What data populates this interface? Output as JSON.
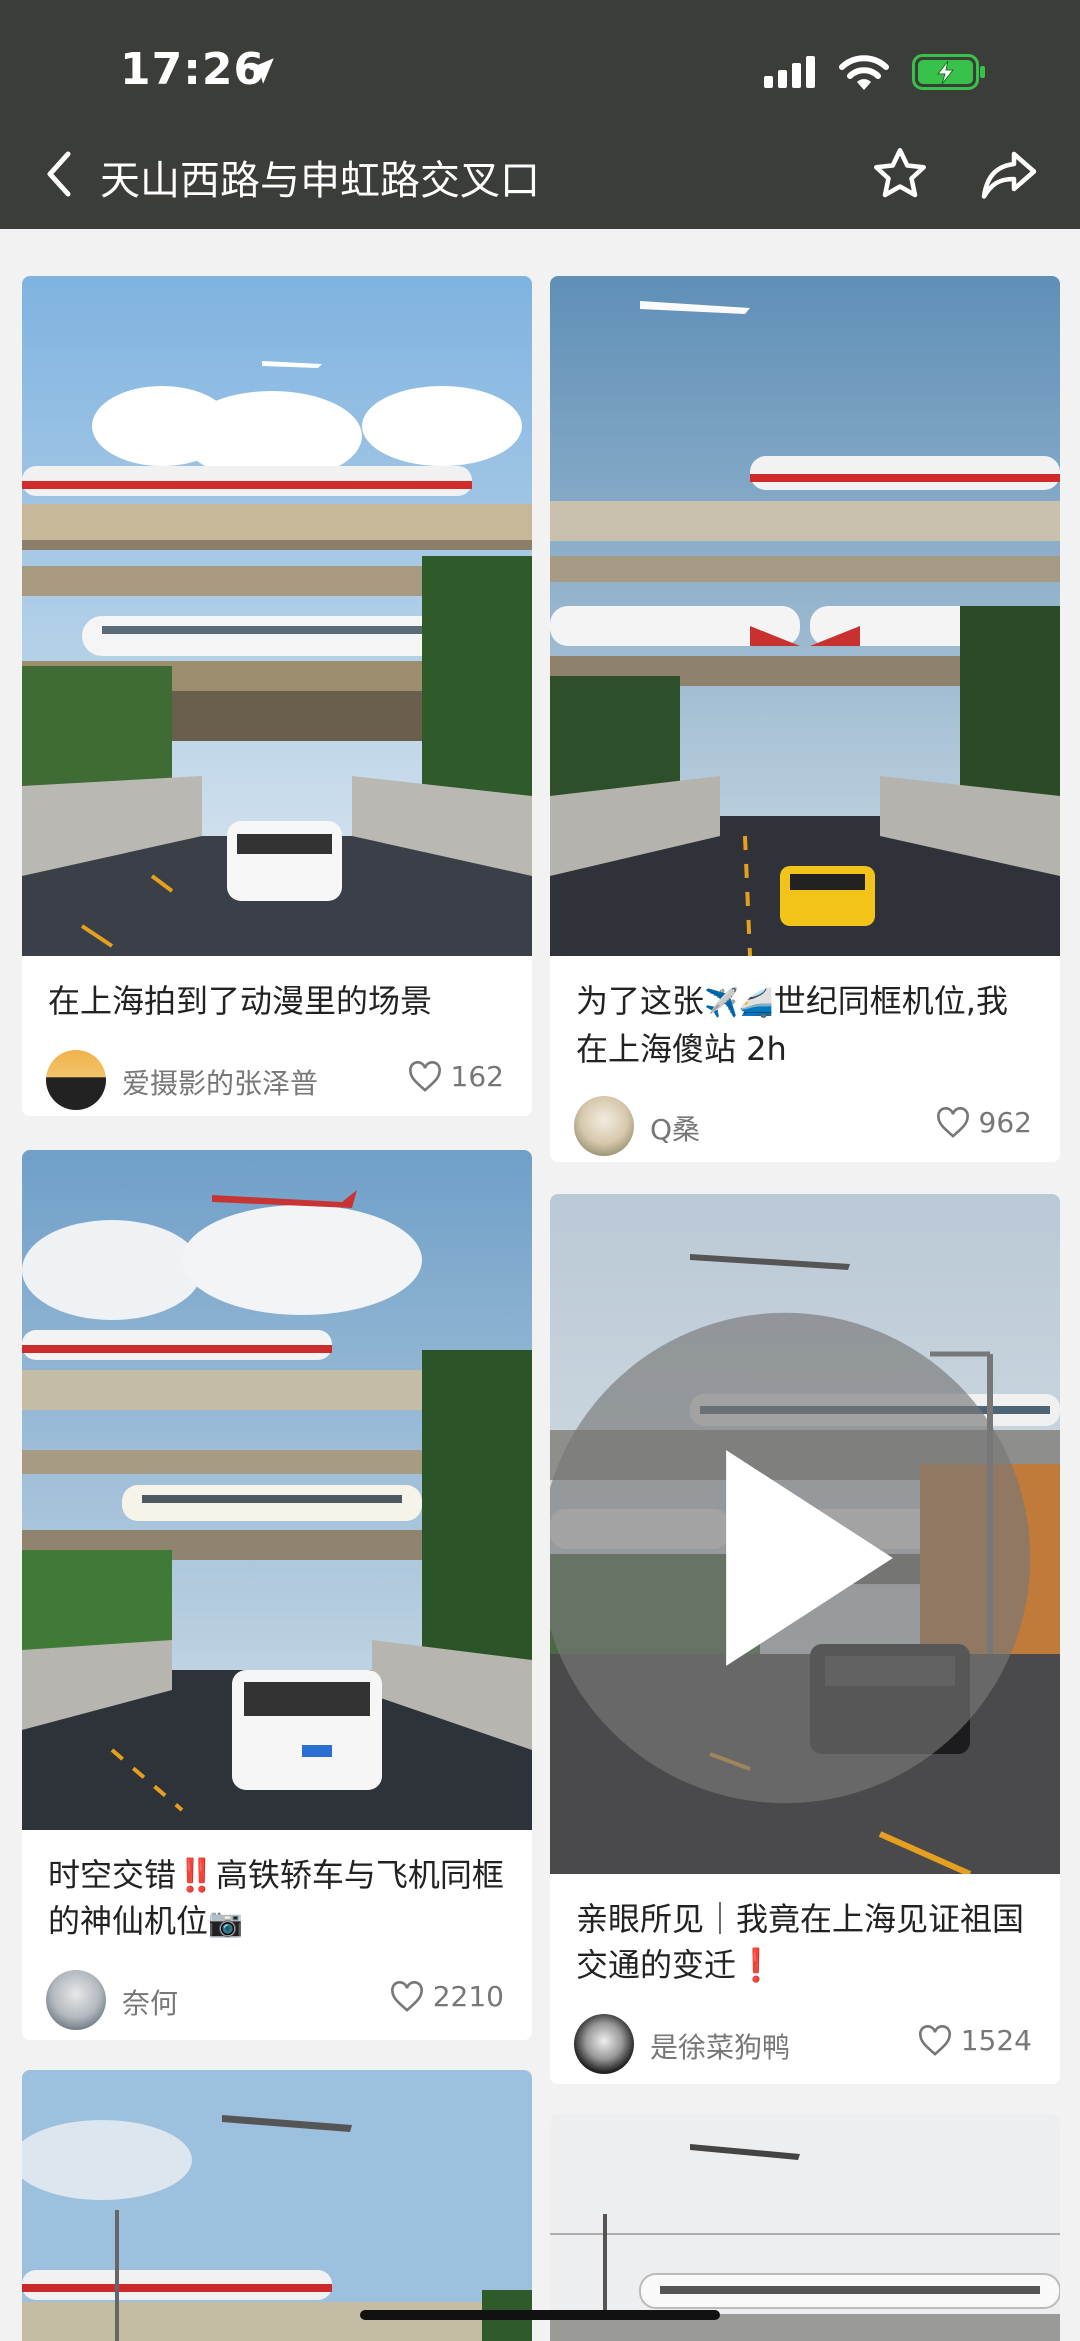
{
  "status": {
    "time": "17:26"
  },
  "nav": {
    "title": "天山西路与申虹路交叉口"
  },
  "cards": [
    {
      "title": "在上海拍到了动漫里的场景",
      "author": "爱摄影的张泽普",
      "likes": "162"
    },
    {
      "title_a": "为了这张",
      "emoji1": "✈️",
      "emoji2": "🚄",
      "title_b": "世纪同框机位,我在上海傻站 2h",
      "author": "Q桑",
      "likes": "962"
    },
    {
      "title_a": "时空交错",
      "mark": "‼️",
      "title_b": "高铁轿车与飞机同框的神仙机位",
      "emoji": "📷",
      "author": "奈何",
      "likes": "2210"
    },
    {
      "title_a": "亲眼所见｜我竟在上海见证祖国交通的变迁",
      "mark": "❗",
      "author": "是徐菜狗鸭",
      "likes": "1524"
    }
  ],
  "colors": {
    "header_bg": "#3b3d38",
    "battery": "#39c24a",
    "title_text": "#222222",
    "meta_text": "#777777"
  },
  "icons": [
    "location-arrow-icon",
    "signal-icon",
    "wifi-icon",
    "battery-icon",
    "back-icon",
    "star-icon",
    "share-icon",
    "heart-icon",
    "play-icon"
  ]
}
